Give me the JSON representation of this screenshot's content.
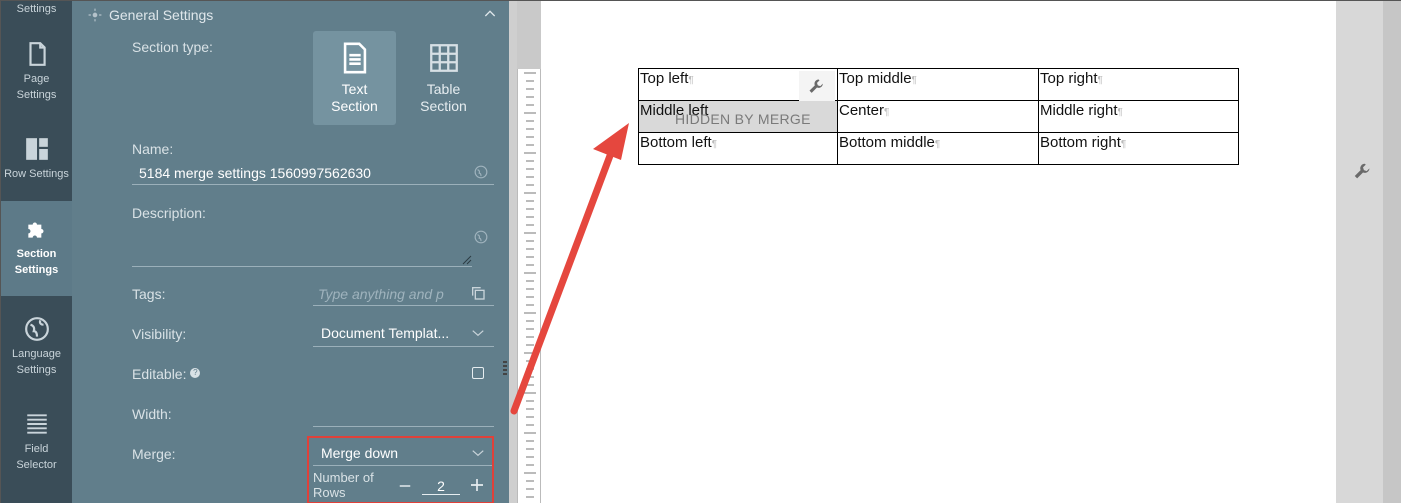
{
  "nav": {
    "items": [
      {
        "id": "settings",
        "label": "Settings"
      },
      {
        "id": "page",
        "label": "Page Settings"
      },
      {
        "id": "row",
        "label": "Row Settings"
      },
      {
        "id": "section",
        "label": "Section Settings",
        "active": true
      },
      {
        "id": "language",
        "label": "Language Settings"
      },
      {
        "id": "field",
        "label": "Field Selector"
      }
    ]
  },
  "panel": {
    "title": "General Settings",
    "section_type_label": "Section type:",
    "section_types": [
      {
        "label": "Text Section",
        "selected": true,
        "icon": "document-icon"
      },
      {
        "label": "Table Section",
        "selected": false,
        "icon": "grid-icon"
      }
    ],
    "name_label": "Name:",
    "name_value": "5184 merge settings 1560997562630",
    "description_label": "Description:",
    "tags_label": "Tags:",
    "tags_placeholder": "Type anything and p",
    "visibility_label": "Visibility:",
    "visibility_value": "Document Templat...",
    "editable_label": "Editable:",
    "width_label": "Width:",
    "merge_label": "Merge:",
    "merge_value": "Merge down",
    "rows_label": "Number of Rows",
    "rows_value": "2"
  },
  "table": {
    "rows": [
      [
        "Top left",
        "Top middle",
        "Top right"
      ],
      [
        "Middle left",
        "Center",
        "Middle right"
      ],
      [
        "Bottom left",
        "Bottom middle",
        "Bottom right"
      ]
    ],
    "hidden_label": "HIDDEN BY MERGE"
  },
  "colors": {
    "nav_bg": "#3a4d58",
    "panel_bg": "#617e8b",
    "highlight": "#e0413a"
  }
}
